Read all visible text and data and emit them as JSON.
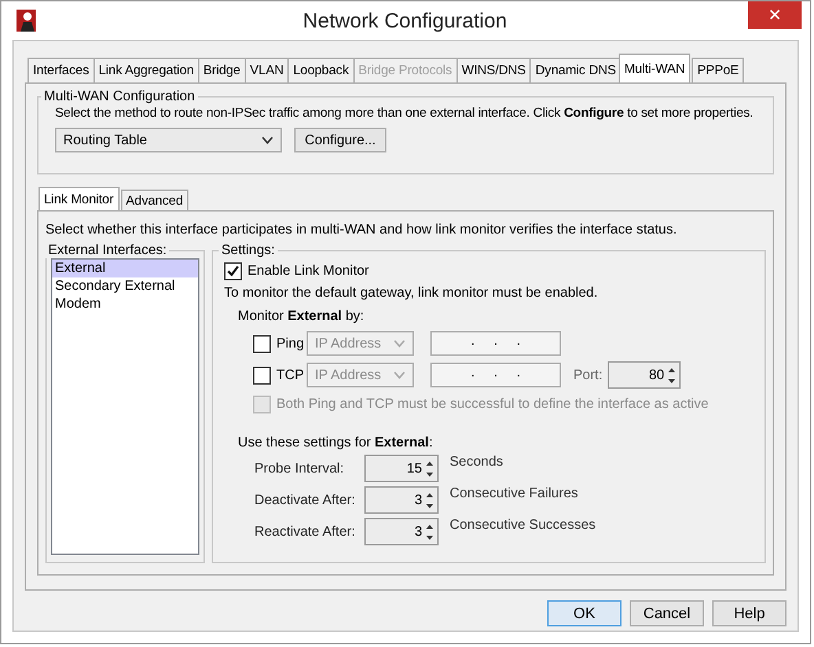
{
  "window": {
    "title": "Network Configuration",
    "close": "✕"
  },
  "tabs": [
    {
      "label": "Interfaces",
      "selected": false,
      "disabled": false
    },
    {
      "label": "Link Aggregation",
      "selected": false,
      "disabled": false
    },
    {
      "label": "Bridge",
      "selected": false,
      "disabled": false
    },
    {
      "label": "VLAN",
      "selected": false,
      "disabled": false
    },
    {
      "label": "Loopback",
      "selected": false,
      "disabled": false
    },
    {
      "label": "Bridge Protocols",
      "selected": false,
      "disabled": true
    },
    {
      "label": "WINS/DNS",
      "selected": false,
      "disabled": false
    },
    {
      "label": "Dynamic DNS",
      "selected": false,
      "disabled": false
    },
    {
      "label": "Multi-WAN",
      "selected": true,
      "disabled": false
    },
    {
      "label": "PPPoE",
      "selected": false,
      "disabled": false
    }
  ],
  "multi_wan": {
    "title": "Multi-WAN Configuration",
    "description": "Select the method to route non-IPSec traffic among more than one external interface. Click **Configure** to set more properties.",
    "method": "Routing Table",
    "configure_button": "Configure..."
  },
  "subtabs": [
    {
      "label": "Link Monitor",
      "selected": true
    },
    {
      "label": "Advanced",
      "selected": false
    }
  ],
  "link_monitor": {
    "description": "Select whether this interface participates in multi-WAN and how link monitor verifies the interface status.",
    "interfaces": {
      "title": "External Interfaces:",
      "items": [
        {
          "label": "External",
          "selected": true
        },
        {
          "label": "Secondary External",
          "selected": false
        },
        {
          "label": "Modem",
          "selected": false
        }
      ]
    },
    "settings": {
      "title": "Settings:",
      "enable": {
        "label": "Enable Link Monitor",
        "checked": true
      },
      "note": "To monitor the default gateway, link monitor must be enabled.",
      "monitor_by": "Monitor **External** by:",
      "methods": [
        {
          "label": "Ping",
          "checked": false,
          "type": "IP Address",
          "address": ".     .     ."
        },
        {
          "label": "TCP",
          "checked": false,
          "type": "IP Address",
          "address": ".     .     .",
          "port_label": "Port:",
          "port": "80"
        }
      ],
      "both": {
        "label": "Both Ping and TCP must be successful to define the interface as active",
        "checked": false,
        "disabled": true
      },
      "use_label": "Use these settings for **External**:",
      "params": [
        {
          "label": "Probe Interval:",
          "value": "15",
          "unit": "Seconds"
        },
        {
          "label": "Deactivate After:",
          "value": "3",
          "unit": "Consecutive Failures"
        },
        {
          "label": "Reactivate After:",
          "value": "3",
          "unit": "Consecutive Successes"
        }
      ]
    }
  },
  "buttons": [
    {
      "label": "OK",
      "default": true
    },
    {
      "label": "Cancel",
      "default": false
    },
    {
      "label": "Help",
      "default": false
    }
  ]
}
